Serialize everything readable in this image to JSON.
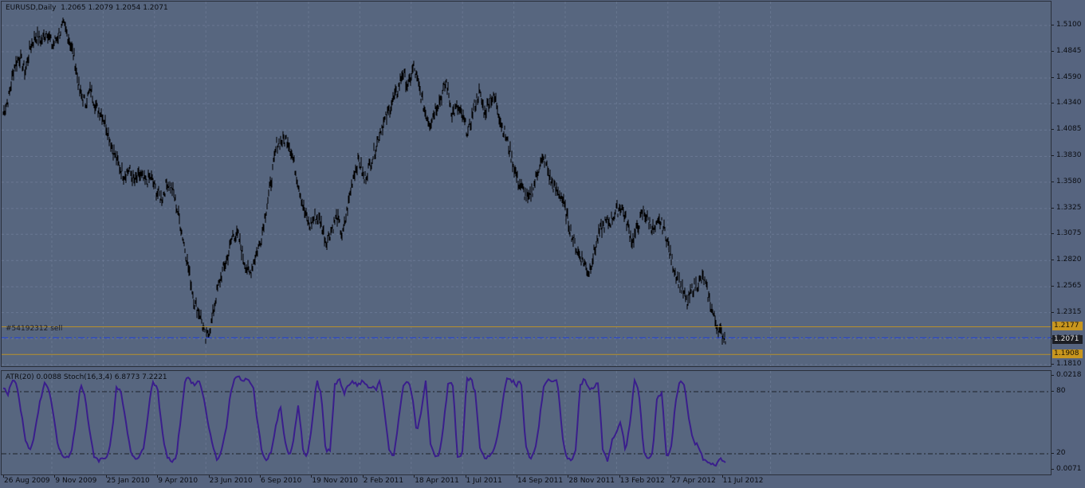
{
  "chart_header": {
    "symbol": "EURUSD,Daily",
    "ohlc": "1.2065 1.2079 1.2054 1.2071"
  },
  "indicator_header": {
    "text": "ATR(20) 0.0088  Stoch(16,3,4) 6.8773 7.2221"
  },
  "order_label": "#54192312 sell",
  "price_axis": [
    "1.5100",
    "1.4845",
    "1.4590",
    "1.4340",
    "1.4085",
    "1.3830",
    "1.3580",
    "1.3325",
    "1.3075",
    "1.2820",
    "1.2565",
    "1.2315",
    "1.2060",
    "1.1810"
  ],
  "price_levels": {
    "upper": "1.2177",
    "current": "1.2071",
    "lower": "1.1908"
  },
  "sub_axis": {
    "top_value": "0.0218",
    "level_high": "80",
    "level_low": "20",
    "bottom_value": "0.0071"
  },
  "time_axis": [
    "26 Aug 2009",
    "9 Nov 2009",
    "25 Jan 2010",
    "9 Apr 2010",
    "23 Jun 2010",
    "6 Sep 2010",
    "19 Nov 2010",
    "2 Feb 2011",
    "18 Apr 2011",
    "1 Jul 2011",
    "14 Sep 2011",
    "28 Nov 2011",
    "13 Feb 2012",
    "27 Apr 2012",
    "11 Jul 2012"
  ],
  "colors": {
    "background": "#56647f",
    "grid": "#6e7c97",
    "candles": "#000000",
    "stoch_line": "#3a1e8c",
    "sl_tp_line": "#b8902a",
    "order_line": "#1f3fe0",
    "badge_gold": "#c8961e",
    "badge_current": "#1c1e24"
  },
  "chart_data": {
    "type": "line",
    "ylim": [
      1.181,
      1.51
    ],
    "series": [
      {
        "values": [
          1.425,
          1.44,
          1.47,
          1.48,
          1.465,
          1.49,
          1.5,
          1.495,
          1.505,
          1.49,
          1.5,
          1.51,
          1.498,
          1.478,
          1.445,
          1.435,
          1.448,
          1.43,
          1.425,
          1.41,
          1.39,
          1.376,
          1.365,
          1.37,
          1.358,
          1.365,
          1.358,
          1.363,
          1.349,
          1.342,
          1.358,
          1.35,
          1.327,
          1.3,
          1.27,
          1.24,
          1.23,
          1.205,
          1.22,
          1.25,
          1.27,
          1.285,
          1.308,
          1.305,
          1.282,
          1.268,
          1.285,
          1.3,
          1.33,
          1.36,
          1.395,
          1.398,
          1.4,
          1.38,
          1.355,
          1.33,
          1.315,
          1.325,
          1.32,
          1.3,
          1.312,
          1.325,
          1.305,
          1.335,
          1.365,
          1.38,
          1.36,
          1.375,
          1.39,
          1.41,
          1.42,
          1.435,
          1.445,
          1.465,
          1.45,
          1.47,
          1.45,
          1.428,
          1.415,
          1.43,
          1.44,
          1.455,
          1.425,
          1.43,
          1.42,
          1.405,
          1.43,
          1.445,
          1.425,
          1.44,
          1.438,
          1.415,
          1.4,
          1.38,
          1.36,
          1.35,
          1.34,
          1.355,
          1.375,
          1.38,
          1.36,
          1.35,
          1.345,
          1.325,
          1.305,
          1.29,
          1.282,
          1.27,
          1.29,
          1.31,
          1.318,
          1.32,
          1.33,
          1.335,
          1.318,
          1.3,
          1.315,
          1.33,
          1.32,
          1.31,
          1.32,
          1.31,
          1.285,
          1.268,
          1.255,
          1.24,
          1.255,
          1.26,
          1.265,
          1.245,
          1.225,
          1.212,
          1.207
        ]
      },
      {
        "values": [
          88,
          80,
          96,
          90,
          60,
          30,
          20,
          40,
          70,
          92,
          88,
          60,
          25,
          15,
          12,
          18,
          50,
          90,
          80,
          40,
          15,
          10,
          12,
          15,
          40,
          90,
          80,
          50,
          20,
          12,
          15,
          25,
          65,
          95,
          85,
          40,
          15,
          8,
          10,
          50,
          95,
          97,
          90,
          97,
          80,
          50,
          30,
          10,
          20,
          40,
          80,
          97,
          99,
          94,
          97,
          90,
          50,
          18,
          8,
          20,
          45,
          70,
          30,
          12,
          35,
          70,
          20,
          15,
          50,
          95,
          80,
          20,
          20,
          90,
          97,
          80,
          90,
          95,
          88,
          95,
          90,
          88,
          85,
          95,
          60,
          20,
          15,
          50,
          88,
          97,
          80,
          40,
          60,
          95,
          30,
          15,
          15,
          50,
          95,
          90,
          15,
          12,
          95,
          98,
          80,
          20,
          12,
          14,
          20,
          40,
          75,
          98,
          95,
          90,
          95,
          25,
          12,
          20,
          50,
          90,
          97,
          92,
          95,
          40,
          12,
          10,
          20,
          90,
          96,
          85,
          88,
          92,
          20,
          10,
          30,
          40,
          50,
          20,
          50,
          96,
          80,
          20,
          12,
          20,
          80,
          80,
          15,
          20,
          72,
          95,
          90,
          50,
          30,
          25,
          12,
          8,
          5,
          6,
          12,
          7
        ]
      }
    ]
  }
}
